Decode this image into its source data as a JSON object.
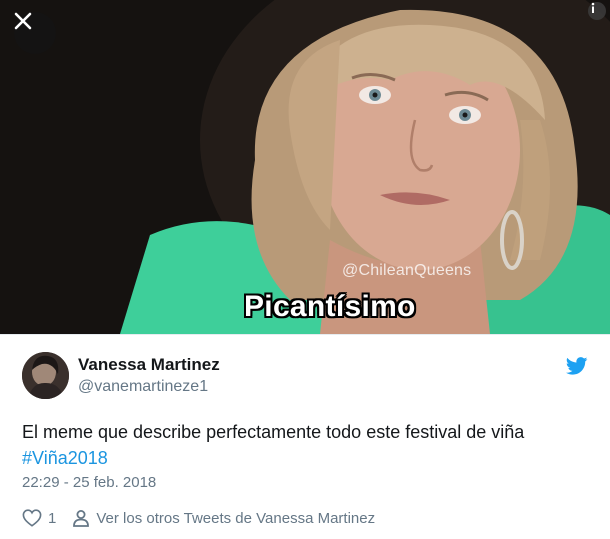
{
  "media": {
    "watermark": "@ChileanQueens",
    "caption": "Picantísimo"
  },
  "tweet": {
    "display_name": "Vanessa Martinez",
    "handle": "@vanemartineze1",
    "text": "El meme que describe perfectamente todo este festival de viña",
    "hashtag": "#Viña2018",
    "timestamp": "22:29 - 25 feb. 2018",
    "like_count": "1",
    "more_tweets_label": "Ver los otros Tweets de Vanessa Martinez"
  },
  "icons": {
    "close": "close-icon",
    "info": "info-icon",
    "brand": "twitter-bird-icon",
    "like": "heart-icon",
    "profile": "person-icon"
  },
  "colors": {
    "link": "#1b95e0",
    "secondary_text": "#657786",
    "primary_text": "#14171a",
    "twitter_blue": "#1da1f2"
  }
}
